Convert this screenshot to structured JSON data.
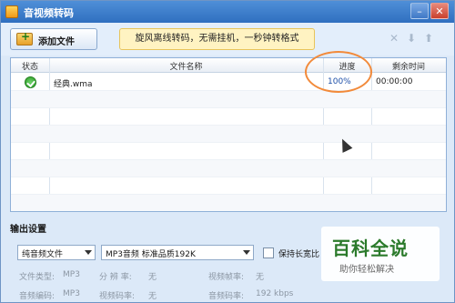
{
  "window": {
    "title": "音视频转码"
  },
  "toolbar": {
    "add_file_label": "添加文件",
    "banner_text": "旋风离线转码，无需挂机，一秒钟转格式"
  },
  "table": {
    "headers": [
      "状态",
      "文件名称",
      "进度",
      "剩余时间"
    ],
    "rows": [
      {
        "status": "done",
        "name": "经典.wma",
        "progress": "100%",
        "remaining": "00:00:00"
      }
    ]
  },
  "output": {
    "section_title": "输出设置",
    "format_select": "纯音频文件",
    "preset_select": "MP3音频 标准品质192K",
    "keep_ratio_label": "保持长宽比",
    "info": {
      "file_type_label": "文件类型:",
      "file_type_value": "MP3",
      "resolution_label": "分 辨 率:",
      "resolution_value": "无",
      "video_fps_label": "视频帧率:",
      "video_fps_value": "无",
      "audio_codec_label": "音频编码:",
      "audio_codec_value": "MP3",
      "video_bitrate_label": "视频码率:",
      "video_bitrate_value": "无",
      "audio_bitrate_label": "音频码率:",
      "audio_bitrate_value": "192 kbps"
    }
  },
  "watermark": {
    "main": "百科全说",
    "sub": "助你轻松解决"
  },
  "colors": {
    "title_bar": "#2f6fc0",
    "highlight_ring": "#f28a3a",
    "success": "#2a9a26"
  }
}
